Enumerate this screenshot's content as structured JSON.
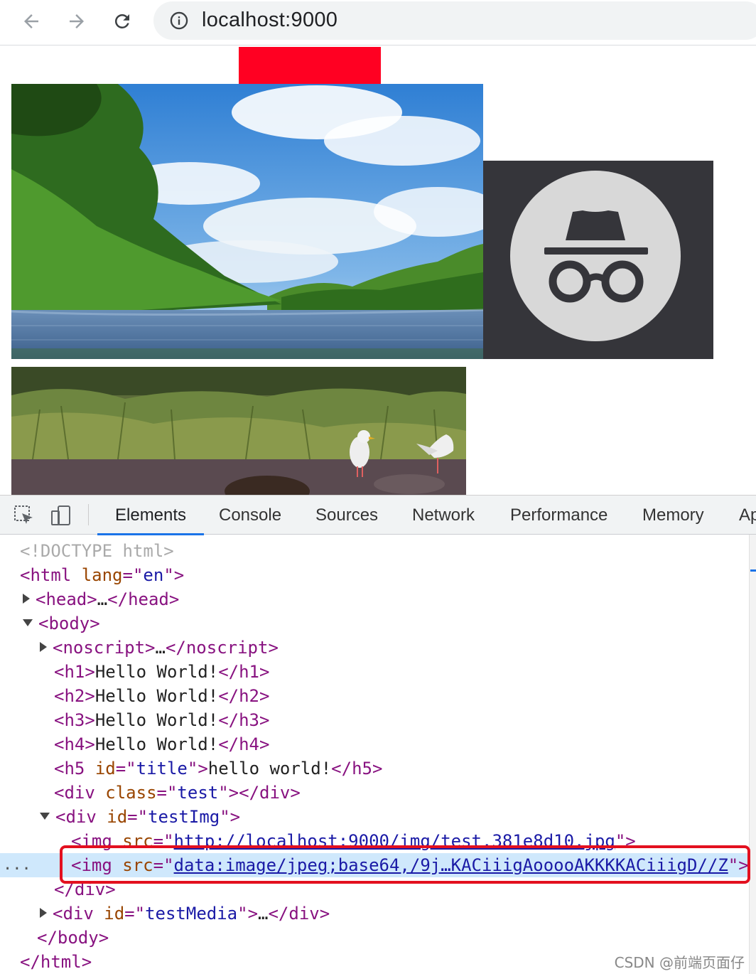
{
  "browser": {
    "url": "localhost:9000",
    "icons": [
      "back-arrow-icon",
      "forward-arrow-icon",
      "reload-icon",
      "info-icon"
    ]
  },
  "page": {
    "red_box_color": "#ff0022",
    "images": [
      "river-landscape-photo",
      "incognito-logo",
      "seagulls-river-photo"
    ]
  },
  "devtools": {
    "tabs": [
      "Elements",
      "Console",
      "Sources",
      "Network",
      "Performance",
      "Memory",
      "Ap"
    ],
    "active_tab": "Elements",
    "dom": {
      "doctype": "<!DOCTYPE html>",
      "html_open_tag": "html",
      "lang_attr": "lang",
      "lang_val": "en",
      "head_tag": "head",
      "body_tag": "body",
      "noscript_tag": "noscript",
      "hello_text": "Hello World!",
      "h1": "h1",
      "h2": "h2",
      "h3": "h3",
      "h4": "h4",
      "h5": "h5",
      "h5_id_attr": "id",
      "h5_id_val": "title",
      "h5_text": "hello world!",
      "div_tag": "div",
      "class_attr": "class",
      "class_val": "test",
      "id_attr": "id",
      "testimg_val": "testImg",
      "img_tag": "img",
      "src_attr": "src",
      "img1_src": "http://localhost:9000/img/test.381e8d10.jpg",
      "img2_src": "data:image/jpeg;base64,/9j…KACiiigAooooAKKKKACiiigD//Z",
      "testmedia_val": "testMedia",
      "ellipsis": "…",
      "gutter_dots": "..."
    }
  },
  "watermark": "CSDN @前端页面仔"
}
